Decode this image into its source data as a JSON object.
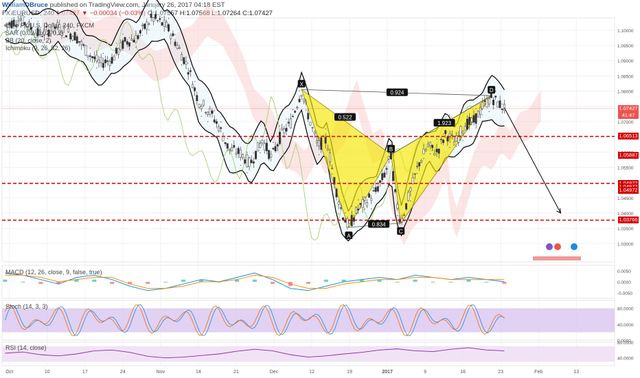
{
  "header": {
    "user": "WilliamDBruce",
    "published": "published on TradingView.com, January 26, 2017 04:18 EST"
  },
  "symbol": {
    "ticker": "FX:EURUSD, 240",
    "last": "1.07427",
    "change": "▼ −0.00034 (−0.03%)",
    "ohlc": "O:1.07557 H:1.07568 L:1.07264 C:1.07427"
  },
  "legends": {
    "main": [
      "Euro FX/U.S. Dollar, 240, FXCM",
      "SAR (0.02, 0.02, 0.2)",
      "BB (20, close, 2)",
      "Ichimoku (9, 26, 52, 26)"
    ],
    "macd": "MACD (12, 26, close, 9, false, true)",
    "stoch": "Stoch (14, 3, 3)",
    "rsi": "RSI (14, close)"
  },
  "colors": {
    "down": "#c62828",
    "up": "#2e7d32",
    "pattern_fill": "#f5e600",
    "level_line": "#d50000",
    "stoch_band": "#d9c6ef",
    "rsi_band": "#efe0f5"
  },
  "price_tags": [
    {
      "label": "1.07427",
      "value": 1.07427,
      "color": "#ef5350"
    },
    {
      "label": "41:47",
      "value": 1.0721,
      "color": "#ef5350"
    },
    {
      "label": "1.06513",
      "value": 1.06513,
      "color": "#d50000"
    },
    {
      "label": "1.05887",
      "value": 1.05887,
      "color": "#d50000"
    },
    {
      "label": "1.04972",
      "value": 1.04972,
      "color": "#d50000"
    },
    {
      "label": "1.04972",
      "value": 1.0486,
      "color": "#d50000"
    },
    {
      "label": "1.04972",
      "value": 1.0474,
      "color": "#d50000"
    },
    {
      "label": "1.03766",
      "value": 1.03766,
      "color": "#d50000"
    }
  ],
  "chart_data": [
    {
      "type": "candlestick",
      "title": "Euro FX/U.S. Dollar, 240, FXCM",
      "ylim": [
        1.024,
        1.104
      ],
      "y_ticks": [
        1.03,
        1.035,
        1.04,
        1.045,
        1.05,
        1.055,
        1.06,
        1.065,
        1.07,
        1.075,
        1.08,
        1.085,
        1.09,
        1.095,
        1.1
      ],
      "y_tick_labels": [
        "1.03000",
        "1.03500",
        "1.04000",
        "1.04500",
        "1.05000",
        "1.05500",
        "1.06000",
        "1.06500",
        "1.07000",
        "1.07500",
        "1.08000",
        "1.08500",
        "1.09000",
        "1.09500",
        "1.10000"
      ],
      "x_ticks": [
        "Oct",
        "10",
        "17",
        "24",
        "Nov",
        "14",
        "21",
        "Dec",
        "12",
        "19",
        "2017",
        "9",
        "16",
        "23",
        "Feb",
        "13"
      ],
      "horizontal_levels": [
        1.06513,
        1.04972,
        1.03766
      ],
      "harmonic_points": [
        {
          "label": "X",
          "t": 0.489,
          "price": 1.0805
        },
        {
          "label": "A",
          "t": 0.566,
          "price": 1.0353
        },
        {
          "label": "B",
          "t": 0.635,
          "price": 1.0592
        },
        {
          "label": "C",
          "t": 0.651,
          "price": 1.0367
        },
        {
          "label": "D",
          "t": 0.799,
          "price": 1.0785
        }
      ],
      "ratios": [
        {
          "label": "0.522",
          "t": 0.56,
          "price": 1.0714
        },
        {
          "label": "0.834",
          "t": 0.615,
          "price": 1.0363
        },
        {
          "label": "1.923",
          "t": 0.722,
          "price": 1.0695
        },
        {
          "label": "0.924",
          "t": 0.645,
          "price": 1.0795
        }
      ],
      "price_path": [
        {
          "t": 0.005,
          "price": 1.1015
        },
        {
          "t": 0.03,
          "price": 1.1035
        },
        {
          "t": 0.06,
          "price": 1.0985
        },
        {
          "t": 0.09,
          "price": 1.101
        },
        {
          "t": 0.12,
          "price": 1.098
        },
        {
          "t": 0.14,
          "price": 1.0925
        },
        {
          "t": 0.16,
          "price": 1.089
        },
        {
          "t": 0.18,
          "price": 1.0905
        },
        {
          "t": 0.2,
          "price": 1.096
        },
        {
          "t": 0.22,
          "price": 1.0975
        },
        {
          "t": 0.245,
          "price": 1.104
        },
        {
          "t": 0.27,
          "price": 1.101
        },
        {
          "t": 0.29,
          "price": 1.0935
        },
        {
          "t": 0.305,
          "price": 1.087
        },
        {
          "t": 0.32,
          "price": 1.077
        },
        {
          "t": 0.34,
          "price": 1.073
        },
        {
          "t": 0.355,
          "price": 1.068
        },
        {
          "t": 0.37,
          "price": 1.061
        },
        {
          "t": 0.39,
          "price": 1.0595
        },
        {
          "t": 0.405,
          "price": 1.056
        },
        {
          "t": 0.425,
          "price": 1.064
        },
        {
          "t": 0.44,
          "price": 1.058
        },
        {
          "t": 0.455,
          "price": 1.0655
        },
        {
          "t": 0.47,
          "price": 1.069
        },
        {
          "t": 0.48,
          "price": 1.075
        },
        {
          "t": 0.489,
          "price": 1.08
        },
        {
          "t": 0.5,
          "price": 1.072
        },
        {
          "t": 0.515,
          "price": 1.062
        },
        {
          "t": 0.53,
          "price": 1.064
        },
        {
          "t": 0.545,
          "price": 1.048
        },
        {
          "t": 0.555,
          "price": 1.04
        },
        {
          "t": 0.566,
          "price": 1.0355
        },
        {
          "t": 0.58,
          "price": 1.041
        },
        {
          "t": 0.595,
          "price": 1.044
        },
        {
          "t": 0.61,
          "price": 1.047
        },
        {
          "t": 0.625,
          "price": 1.053
        },
        {
          "t": 0.635,
          "price": 1.059
        },
        {
          "t": 0.642,
          "price": 1.046
        },
        {
          "t": 0.651,
          "price": 1.037
        },
        {
          "t": 0.665,
          "price": 1.046
        },
        {
          "t": 0.68,
          "price": 1.056
        },
        {
          "t": 0.695,
          "price": 1.062
        },
        {
          "t": 0.71,
          "price": 1.06
        },
        {
          "t": 0.725,
          "price": 1.066
        },
        {
          "t": 0.74,
          "price": 1.063
        },
        {
          "t": 0.755,
          "price": 1.069
        },
        {
          "t": 0.77,
          "price": 1.07
        },
        {
          "t": 0.785,
          "price": 1.075
        },
        {
          "t": 0.799,
          "price": 1.078
        },
        {
          "t": 0.81,
          "price": 1.076
        },
        {
          "t": 0.82,
          "price": 1.0745
        }
      ],
      "projection": [
        {
          "t": 0.82,
          "price": 1.0745
        },
        {
          "t": 0.912,
          "price": 1.04
        }
      ]
    },
    {
      "type": "line",
      "title": "MACD (12, 26, close, 9, false, true)",
      "ylim": [
        -0.0075,
        0.0075
      ],
      "y_ticks": [
        0.005,
        0.0,
        -0.005
      ],
      "y_tick_labels": [
        "0.0050",
        "0.0000",
        "-0.0050"
      ],
      "series": [
        {
          "values": [
            0.004,
            0.003,
            0.001,
            -0.001,
            0.002,
            0.003,
            0.001,
            -0.002,
            -0.004,
            -0.003,
            -0.001,
            0.001,
            0.0,
            0.002,
            0.004,
            0.001,
            -0.003,
            -0.004,
            -0.002,
            0.0,
            0.001,
            0.002,
            0.001,
            0.003,
            0.002,
            0.001,
            0.002,
            0.001,
            0.0
          ]
        },
        {
          "values": [
            0.003,
            0.003,
            0.002,
            0.0,
            0.001,
            0.002,
            0.002,
            -0.001,
            -0.003,
            -0.003,
            -0.002,
            0.0,
            0.0,
            0.001,
            0.003,
            0.002,
            -0.001,
            -0.003,
            -0.003,
            -0.001,
            0.0,
            0.001,
            0.001,
            0.002,
            0.002,
            0.001,
            0.001,
            0.001,
            0.001
          ]
        }
      ]
    },
    {
      "type": "line",
      "title": "Stoch (14, 3, 3)",
      "ylim": [
        0,
        100
      ],
      "y_ticks": [
        80,
        40,
        0
      ],
      "y_tick_labels": [
        "80.0000",
        "40.0000",
        "0.0000"
      ]
    },
    {
      "type": "line",
      "title": "RSI (14, close)",
      "ylim": [
        20,
        80
      ],
      "y_ticks": [
        80,
        40
      ],
      "y_tick_labels": [
        "80.0000",
        "40.0000"
      ],
      "series": [
        {
          "values": [
            52,
            55,
            48,
            45,
            50,
            58,
            60,
            54,
            44,
            40,
            42,
            46,
            50,
            57,
            62,
            58,
            48,
            42,
            45,
            50,
            54,
            60,
            63,
            58,
            56,
            62,
            66,
            60,
            58
          ]
        }
      ]
    }
  ]
}
